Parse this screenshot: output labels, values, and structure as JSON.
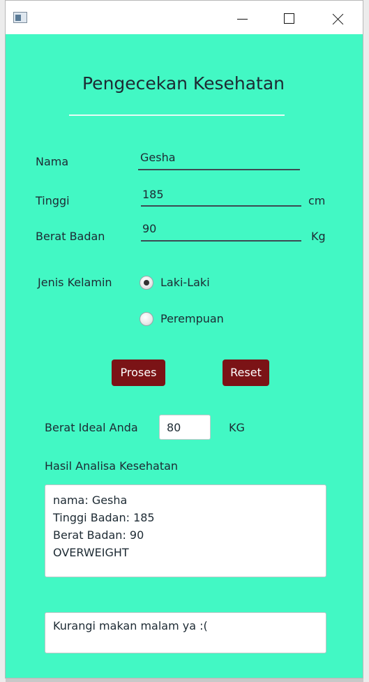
{
  "window": {
    "controls": {
      "minimize": "minimize-icon",
      "maximize": "maximize-icon",
      "close": "close-icon"
    }
  },
  "form": {
    "title": "Pengecekan Kesehatan",
    "nama": {
      "label": "Nama",
      "value": "Gesha"
    },
    "tinggi": {
      "label": "Tinggi",
      "value": "185",
      "unit": "cm"
    },
    "berat": {
      "label": "Berat Badan",
      "value": "90",
      "unit": "Kg"
    },
    "jenis_kelamin": {
      "label": "Jenis Kelamin",
      "options": [
        "Laki-Laki",
        "Perempuan"
      ],
      "selected": "Laki-Laki"
    },
    "buttons": {
      "proses": "Proses",
      "reset": "Reset"
    },
    "berat_ideal": {
      "label": "Berat Ideal Anda",
      "value": "80",
      "unit": "KG"
    },
    "hasil": {
      "label": "Hasil Analisa Kesehatan",
      "text": "nama:  Gesha\nTinggi Badan:  185\nBerat Badan: 90\nOVERWEIGHT"
    },
    "saran": "Kurangi makan malam ya :("
  },
  "colors": {
    "background": "#42f8c4",
    "button": "#7b1316"
  }
}
